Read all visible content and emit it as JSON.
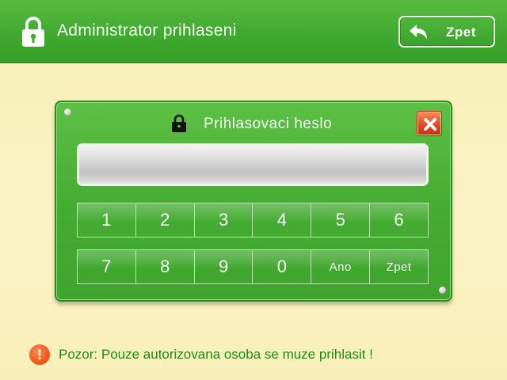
{
  "header": {
    "title": "Administrator prihlaseni",
    "back_label": "Zpet"
  },
  "dialog": {
    "title": "Prihlasovaci heslo",
    "password_value": "",
    "keys_row1": [
      "1",
      "2",
      "3",
      "4",
      "5",
      "6"
    ],
    "keys_row2": [
      "7",
      "8",
      "9",
      "0",
      "Ano",
      "Zpet"
    ]
  },
  "footer": {
    "warning_icon": "!",
    "warning_text": "Pozor: Pouze autorizovana osoba se muze prihlasit !"
  },
  "colors": {
    "header_green": "#40a92f",
    "panel_green": "#46ad33",
    "close_red": "#e34421",
    "warning_orange": "#f05a1a",
    "warning_text_green": "#1f8a17",
    "background": "#fbf3c4"
  },
  "icons": {
    "header": "padlock-icon",
    "back": "back-arrow-icon",
    "dialog": "padlock-icon",
    "close": "close-icon",
    "warning": "exclamation-icon"
  }
}
